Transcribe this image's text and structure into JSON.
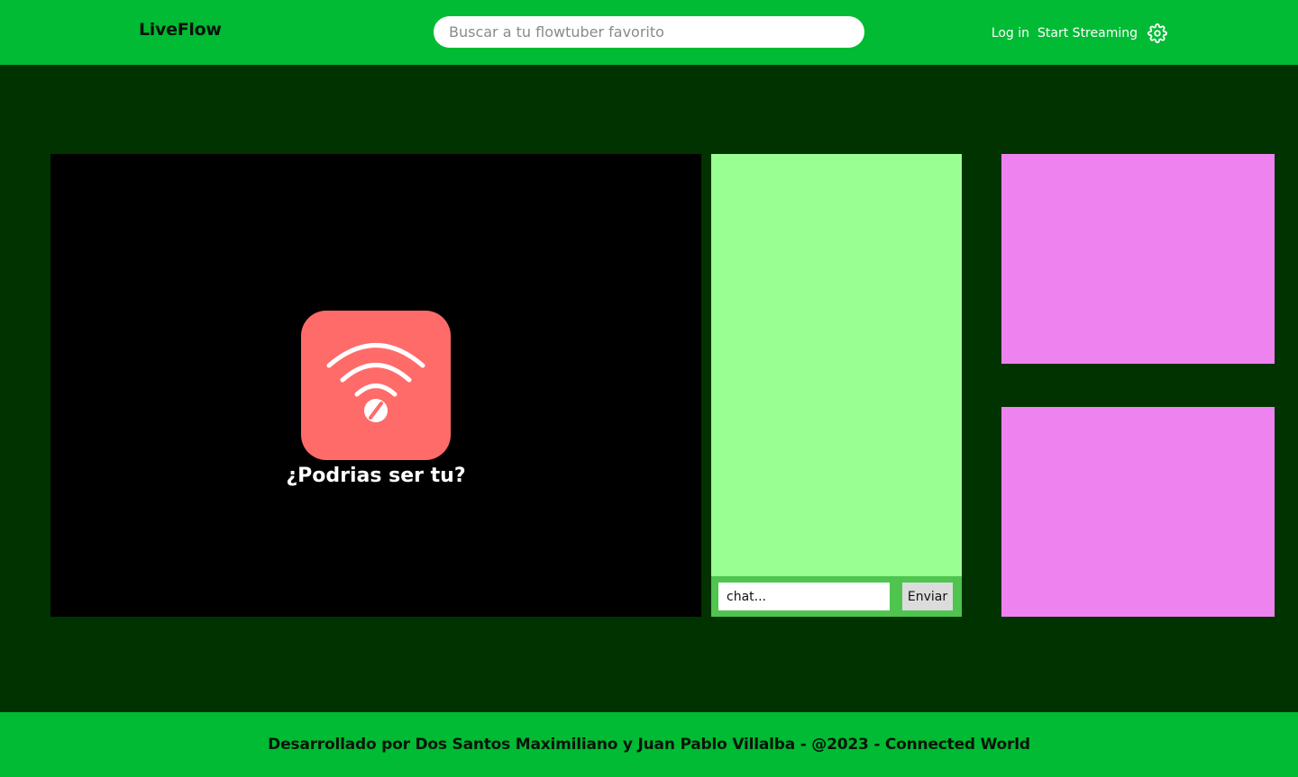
{
  "header": {
    "logo": "LiveFlow",
    "search_placeholder": "Buscar a tu flowtuber favorito",
    "login_label": "Log in",
    "start_streaming_label": "Start Streaming",
    "settings_icon": "gear-icon"
  },
  "player": {
    "icon": "wifi-off-icon",
    "message": "¿Podrias ser tu?"
  },
  "chat": {
    "input_placeholder": "chat...",
    "send_label": "Enviar"
  },
  "footer": {
    "text": "Desarrollado por Dos Santos Maximiliano y Juan Pablo Villalba - @2023 - Connected World"
  },
  "colors": {
    "header_bg": "#00bb33",
    "page_bg": "#003300",
    "player_bg": "#000000",
    "offline_icon_bg": "#ff6b69",
    "chat_bg": "#99ff93",
    "chat_bar_bg": "#4fc44f",
    "side_panel_bg": "#ee82ee"
  }
}
